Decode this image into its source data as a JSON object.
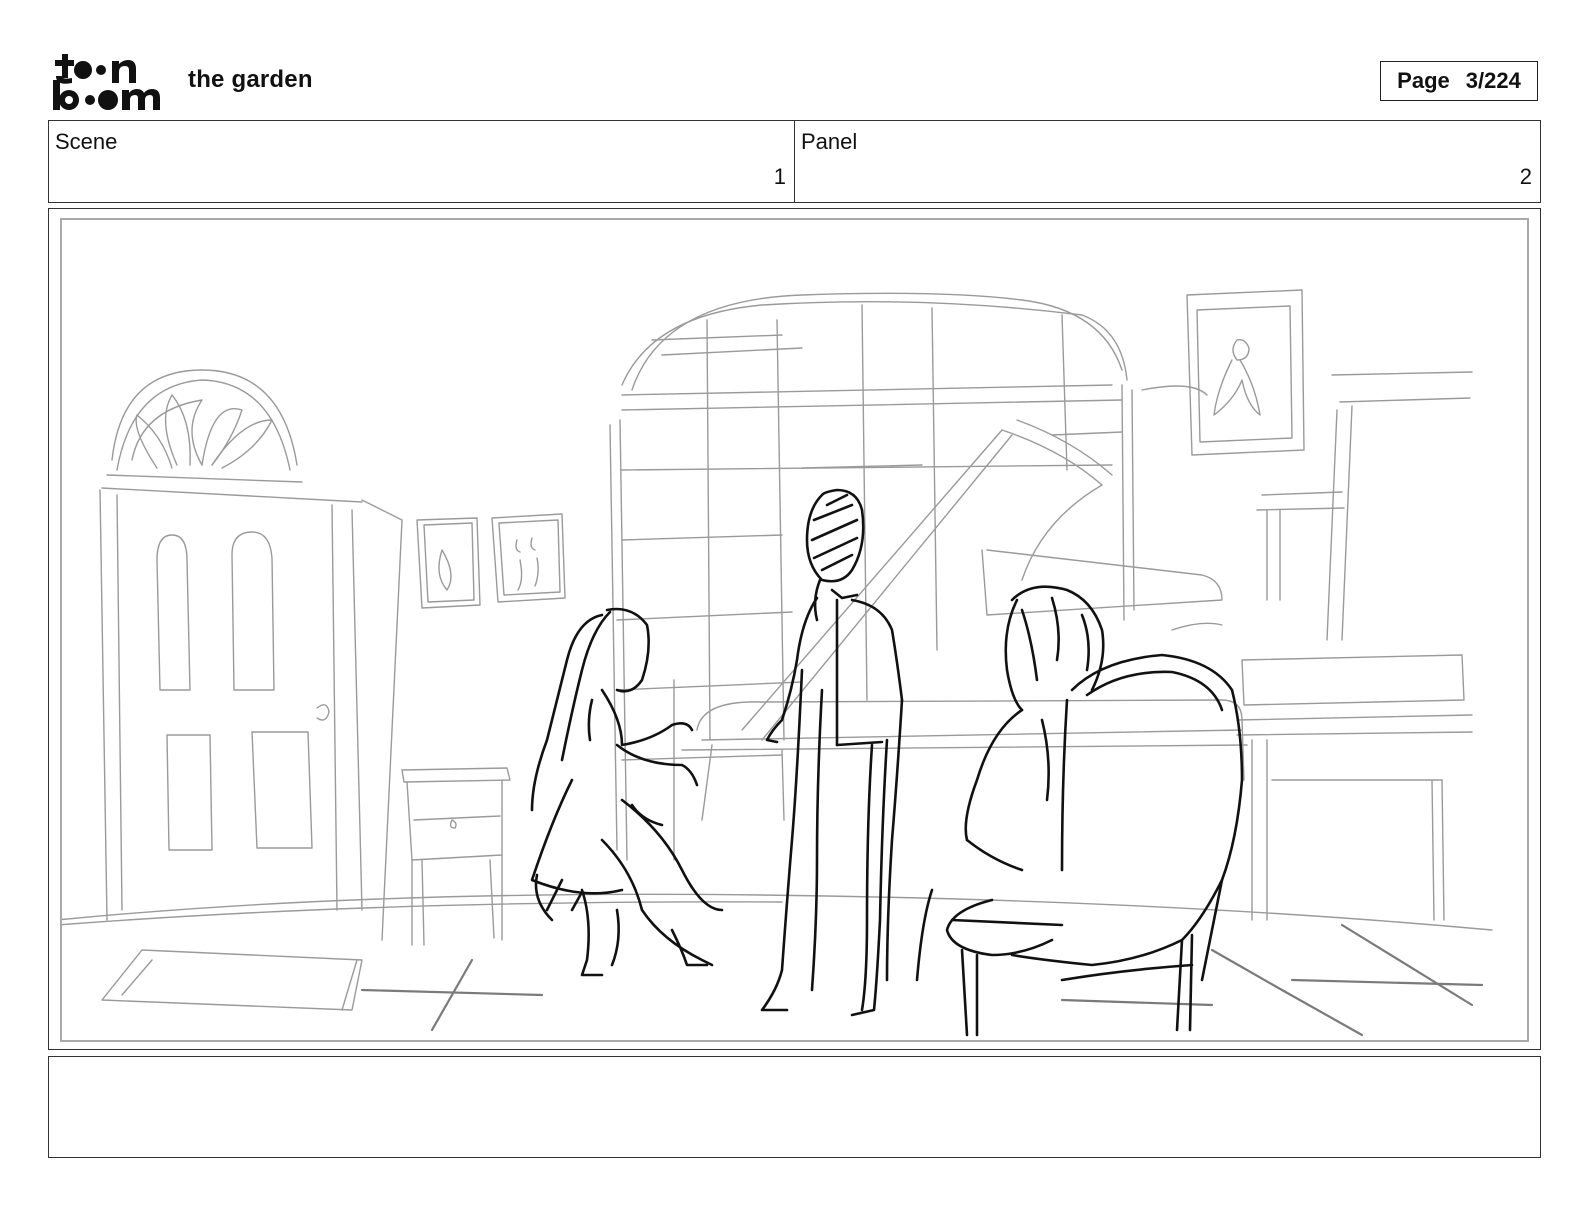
{
  "header": {
    "logo_text_top": "toon",
    "logo_text_bottom": "boom",
    "project_title": "the garden",
    "page_label": "Page",
    "page_value": "3/224"
  },
  "info": {
    "scene_label": "Scene",
    "scene_value": "1",
    "panel_label": "Panel",
    "panel_value": "2"
  },
  "notes": {
    "text": ""
  }
}
